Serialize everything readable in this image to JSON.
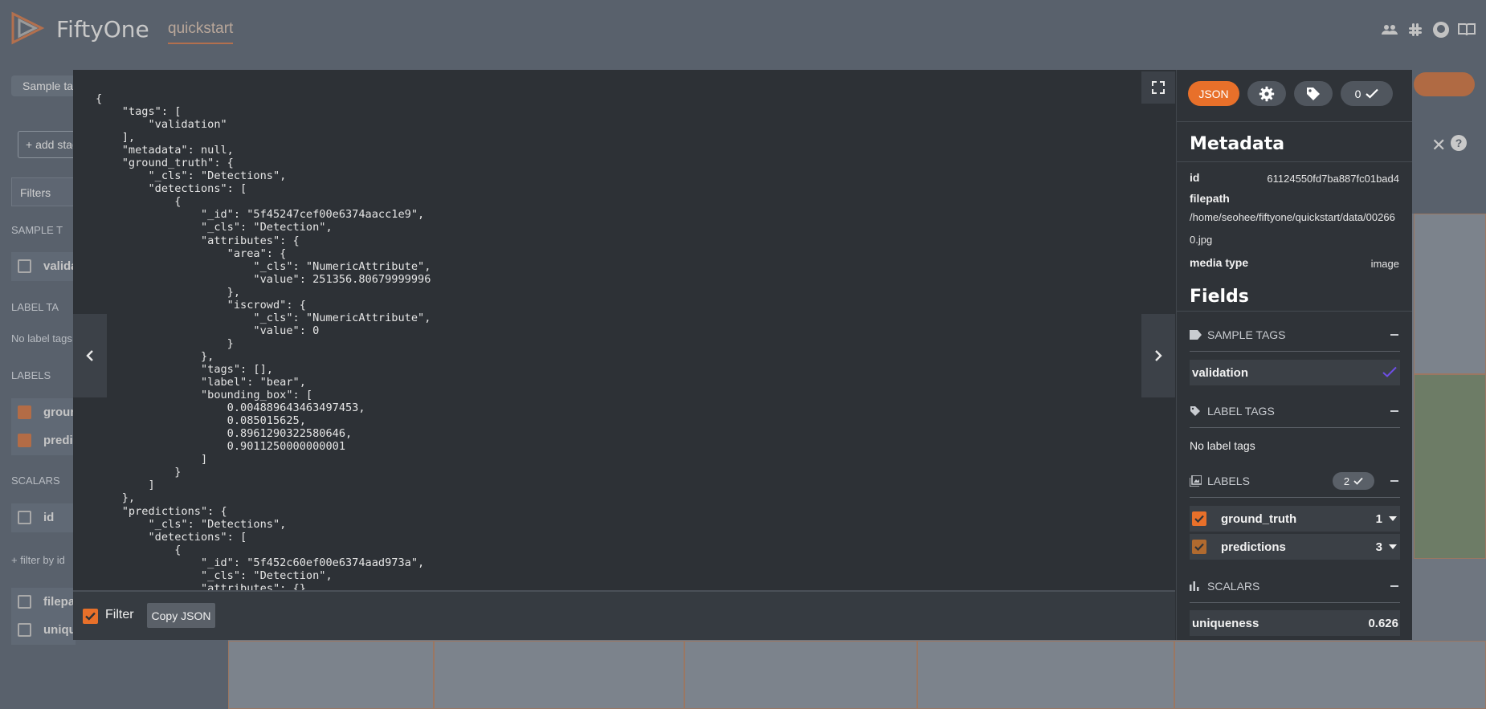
{
  "app": {
    "brand": "FiftyOne",
    "dataset": "quickstart",
    "header_icons": [
      "people-icon",
      "slack-icon",
      "github-icon",
      "docs-book-icon"
    ]
  },
  "background": {
    "sample_tags_chip": "Sample tag",
    "add_stage": "+ add stag",
    "filters": "Filters",
    "section_sample_tags": "SAMPLE T",
    "validation_row": "valida",
    "section_label_tags": "LABEL TA",
    "no_label_tags": "No label tags",
    "section_labels": "LABELS",
    "label_rows": [
      "groun",
      "predic"
    ],
    "section_scalars": "SCALARS",
    "id_row": "id",
    "filter_by_id": "+ filter by id",
    "filepath_row": "filepa",
    "uniqueness_row": "uniqu"
  },
  "modal": {
    "json_text": "{\n    \"tags\": [\n        \"validation\"\n    ],\n    \"metadata\": null,\n    \"ground_truth\": {\n        \"_cls\": \"Detections\",\n        \"detections\": [\n            {\n                \"_id\": \"5f45247cef00e6374aacc1e9\",\n                \"_cls\": \"Detection\",\n                \"attributes\": {\n                    \"area\": {\n                        \"_cls\": \"NumericAttribute\",\n                        \"value\": 251356.80679999996\n                    },\n                    \"iscrowd\": {\n                        \"_cls\": \"NumericAttribute\",\n                        \"value\": 0\n                    }\n                },\n                \"tags\": [],\n                \"label\": \"bear\",\n                \"bounding_box\": [\n                    0.004889643463497453,\n                    0.085015625,\n                    0.8961290322580646,\n                    0.9011250000000001\n                ]\n            }\n        ]\n    },\n    \"predictions\": {\n        \"_cls\": \"Detections\",\n        \"detections\": [\n            {\n                \"_id\": \"5f452c60ef00e6374aad973a\",\n                \"_cls\": \"Detection\",\n                \"attributes\": {},",
    "footer": {
      "filter_label": "Filter",
      "filter_checked": true,
      "copy_button": "Copy JSON"
    },
    "panel": {
      "json_button": "JSON",
      "selected_count": "0",
      "metadata_title": "Metadata",
      "metadata": {
        "id_key": "id",
        "id_value": "61124550fd7ba887fc01bad4",
        "filepath_key": "filepath",
        "filepath_value": "/home/seohee/fiftyone/quickstart/data/002660.jpg",
        "media_type_key": "media type",
        "media_type_value": "image"
      },
      "fields_title": "Fields",
      "sample_tags": {
        "title": "SAMPLE TAGS",
        "items": [
          {
            "label": "validation"
          }
        ]
      },
      "label_tags": {
        "title": "LABEL TAGS",
        "empty_text": "No label tags"
      },
      "labels": {
        "title": "LABELS",
        "badge_count": "2",
        "items": [
          {
            "label": "ground_truth",
            "count": "1",
            "color": "#e8702a"
          },
          {
            "label": "predictions",
            "count": "3",
            "color": "#b06a2f"
          }
        ]
      },
      "scalars": {
        "title": "SCALARS",
        "items": [
          {
            "label": "uniqueness",
            "value": "0.626"
          }
        ]
      }
    }
  },
  "colors": {
    "accent": "#e8702a",
    "panel_bg": "#2f3338",
    "json_bg": "#2d3136",
    "validation_check": "#6e4ee6"
  }
}
